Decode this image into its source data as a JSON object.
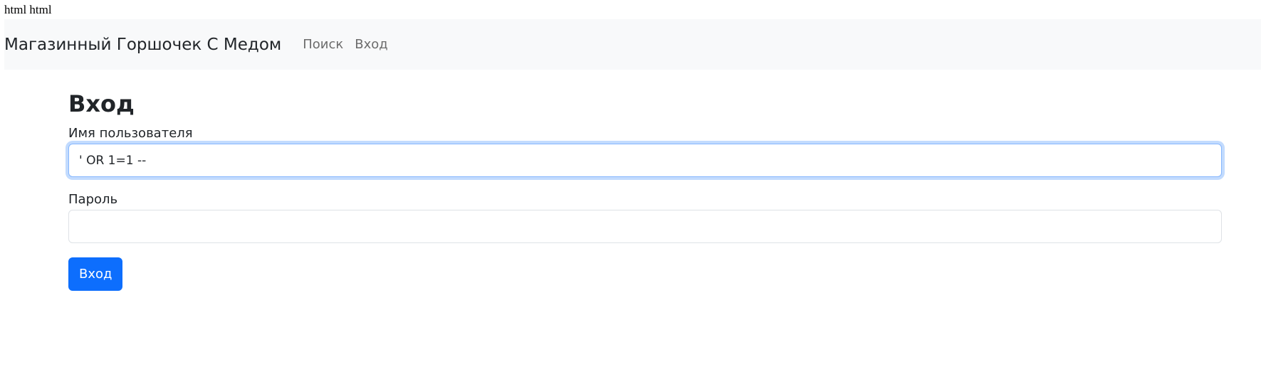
{
  "raw_text": "html html",
  "navbar": {
    "brand": "Магазинный Горшочек С Медом",
    "links": [
      "Поиск",
      "Вход"
    ]
  },
  "login": {
    "title": "Вход",
    "username_label": "Имя пользователя",
    "username_value": "' OR 1=1 --",
    "password_label": "Пароль",
    "password_value": "",
    "submit_label": "Вход"
  },
  "colors": {
    "navbar_bg": "#f8f9fa",
    "primary": "#0d6efd",
    "focus_border": "#86b7fe"
  }
}
